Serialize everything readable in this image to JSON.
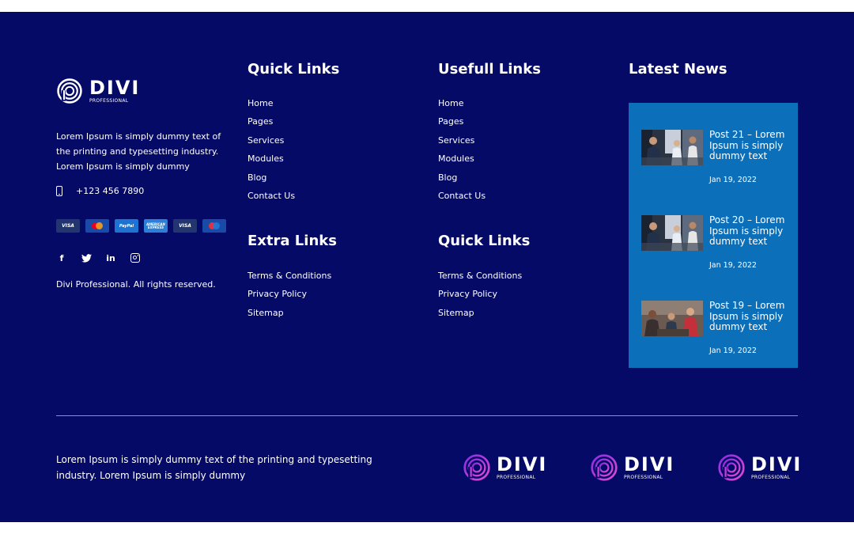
{
  "brand": {
    "logo_word": "DIVI",
    "logo_sub": "PROFESSIONAL",
    "description": "Lorem Ipsum is simply dummy text of the printing and typesetting industry. Lorem Ipsum is simply dummy",
    "phone": "+123 456 7890",
    "payments": [
      {
        "label": "VISA",
        "icon": "visa-icon"
      },
      {
        "label": "",
        "icon": "mastercard-icon"
      },
      {
        "label": "PayPal",
        "icon": "paypal-icon"
      },
      {
        "label": "AMERICAN EXPRESS",
        "icon": "amex-icon"
      },
      {
        "label": "VISA",
        "icon": "visa-icon"
      },
      {
        "label": "",
        "icon": "maestro-icon"
      }
    ],
    "social": [
      "facebook-icon",
      "twitter-icon",
      "linkedin-icon",
      "instagram-icon"
    ],
    "social_labels": {
      "facebook": "f",
      "linkedin": "in"
    },
    "copyright": "Divi Professional. All rights reserved."
  },
  "quick_links": {
    "title": "Quick Links",
    "items": [
      "Home",
      "Pages",
      "Services",
      "Modules",
      "Blog",
      "Contact Us"
    ]
  },
  "extra_links": {
    "title": "Extra Links",
    "items": [
      "Terms & Conditions",
      "Privacy Policy",
      "Sitemap"
    ]
  },
  "useful_links": {
    "title": "Usefull Links",
    "items": [
      "Home",
      "Pages",
      "Services",
      "Modules",
      "Blog",
      "Contact Us"
    ]
  },
  "quick_links_2": {
    "title": "Quick Links",
    "items": [
      "Terms & Conditions",
      "Privacy Policy",
      "Sitemap"
    ]
  },
  "latest_news": {
    "title": "Latest News",
    "posts": [
      {
        "title": "Post 21 – Lorem Ipsum is simply dummy text",
        "date": "Jan 19, 2022"
      },
      {
        "title": "Post 20 – Lorem Ipsum is simply dummy text",
        "date": "Jan 19, 2022"
      },
      {
        "title": "Post 19 – Lorem Ipsum is simply dummy text",
        "date": "Jan 19, 2022"
      }
    ]
  },
  "bottom": {
    "text": "Lorem Ipsum is simply dummy text of the printing and typesetting industry. Lorem Ipsum is simply dummy",
    "logo_word": "DIVI",
    "logo_sub": "PROFESSIONAL"
  },
  "colors": {
    "footer_bg": "#050a66",
    "news_bg": "#0c6fba",
    "logo_accent": "#c03fd6"
  }
}
